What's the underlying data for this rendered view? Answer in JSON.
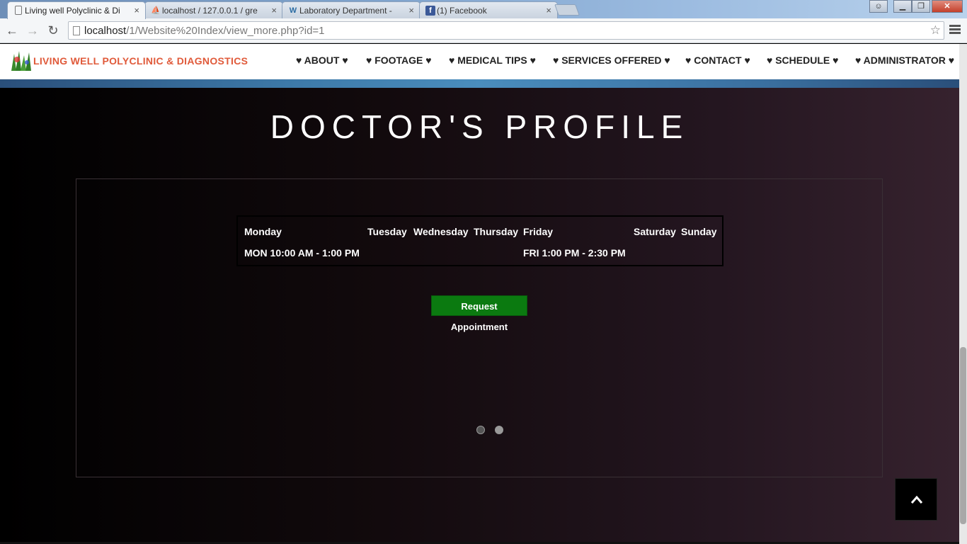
{
  "browser": {
    "tabs": [
      {
        "title": "Living well Polyclinic & Di",
        "favicon": "page-icon",
        "active": true
      },
      {
        "title": "localhost / 127.0.0.1 / gre",
        "favicon": "phpmyadmin-icon",
        "active": false
      },
      {
        "title": "Laboratory Department - ",
        "favicon": "wordpress-icon",
        "active": false
      },
      {
        "title": "(1) Facebook",
        "favicon": "facebook-icon",
        "active": false
      }
    ],
    "close_glyph": "×",
    "url_host": "localhost",
    "url_path": "/1/Website%20Index/view_more.php?id=1"
  },
  "site": {
    "brand": "LIVING WELL POLYCLINIC & DIAGNOSTICS",
    "nav": [
      "♥ ABOUT ♥",
      "♥ FOOTAGE ♥",
      "♥ MEDICAL TIPS ♥",
      "♥ SERVICES OFFERED ♥",
      "♥ CONTACT ♥",
      "♥ SCHEDULE ♥",
      "♥ ADMINISTRATOR ♥"
    ]
  },
  "main": {
    "title": "DOCTOR'S PROFILE",
    "schedule": {
      "days": [
        "Monday",
        "Tuesday",
        "Wednesday",
        "Thursday",
        "Friday",
        "Saturday",
        "Sunday"
      ],
      "hours": [
        "MON 10:00 AM - 1:00 PM",
        "",
        "",
        "",
        "FRI 1:00 PM - 2:30 PM",
        "",
        ""
      ]
    },
    "request_button": "Request Appointment",
    "carousel": {
      "slides": 2,
      "active": 2
    }
  },
  "colors": {
    "brand": "#e05a3a",
    "button": "#0b7a10"
  }
}
